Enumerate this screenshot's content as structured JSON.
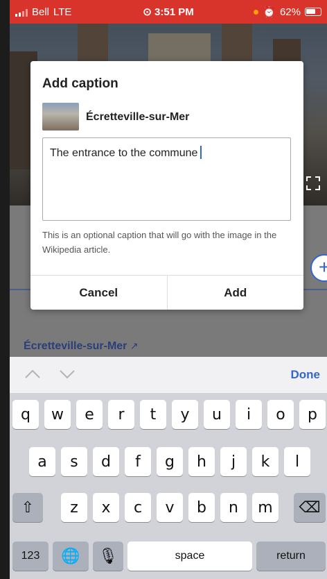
{
  "status_bar": {
    "carrier": "Bell",
    "network": "LTE",
    "time": "3:51 PM",
    "battery": "62%"
  },
  "article": {
    "link_text": "Écretteville-sur-Mer"
  },
  "dialog": {
    "title": "Add caption",
    "article_name": "Écretteville-sur-Mer",
    "caption_value": "The entrance to the commune",
    "helper_text": "This is an optional caption that will go with the image in the Wikipedia article.",
    "cancel_label": "Cancel",
    "add_label": "Add"
  },
  "keyboard": {
    "done_label": "Done",
    "row1": [
      "q",
      "w",
      "e",
      "r",
      "t",
      "y",
      "u",
      "i",
      "o",
      "p"
    ],
    "row2": [
      "a",
      "s",
      "d",
      "f",
      "g",
      "h",
      "j",
      "k",
      "l"
    ],
    "row3": [
      "z",
      "x",
      "c",
      "v",
      "b",
      "n",
      "m"
    ],
    "numbers_label": "123",
    "space_label": "space",
    "return_label": "return"
  },
  "colors": {
    "status_bar": "#d9342b",
    "accent": "#3366cc",
    "keyboard_bg": "#d1d3d9"
  },
  "icons": [
    "signal-icon",
    "alarm-icon",
    "battery-icon",
    "location-icon",
    "external-link-icon",
    "expand-icon",
    "plus-icon",
    "chevron-up-icon",
    "chevron-down-icon",
    "shift-icon",
    "backspace-icon",
    "globe-icon",
    "microphone-icon"
  ]
}
